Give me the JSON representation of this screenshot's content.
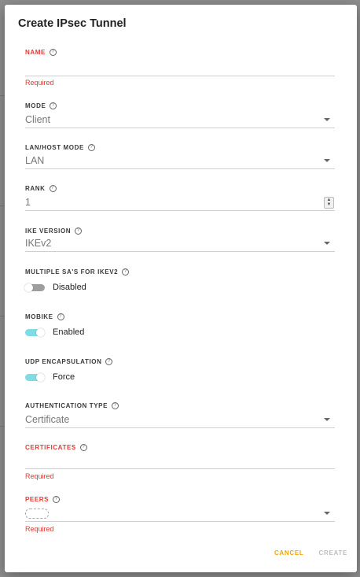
{
  "dialog": {
    "title": "Create IPsec Tunnel",
    "name": {
      "label": "NAME",
      "value": "",
      "error": "Required"
    },
    "mode": {
      "label": "MODE",
      "value": "Client"
    },
    "lan_host_mode": {
      "label": "LAN/HOST MODE",
      "value": "LAN"
    },
    "rank": {
      "label": "RANK",
      "value": "1"
    },
    "ike_version": {
      "label": "IKE VERSION",
      "value": "IKEv2"
    },
    "multiple_sa": {
      "label": "MULTIPLE SA'S FOR IKEV2",
      "state": "Disabled",
      "on": false
    },
    "mobike": {
      "label": "MOBIKE",
      "state": "Enabled",
      "on": true
    },
    "udp_encapsulation": {
      "label": "UDP ENCAPSULATION",
      "state": "Force",
      "on": true
    },
    "authentication_type": {
      "label": "AUTHENTICATION TYPE",
      "value": "Certificate"
    },
    "certificates": {
      "label": "CERTIFICATES",
      "value": "",
      "error": "Required"
    },
    "peers": {
      "label": "PEERS",
      "error": "Required"
    },
    "actions": {
      "cancel": "CANCEL",
      "create": "CREATE"
    }
  },
  "icons": {
    "help": "help-circle-icon",
    "dropdown": "chevron-down-icon"
  },
  "colors": {
    "error": "#e53935",
    "accent": "#f0a500",
    "toggle_on": "#7fdce5",
    "disabled": "#bdbdbd"
  }
}
